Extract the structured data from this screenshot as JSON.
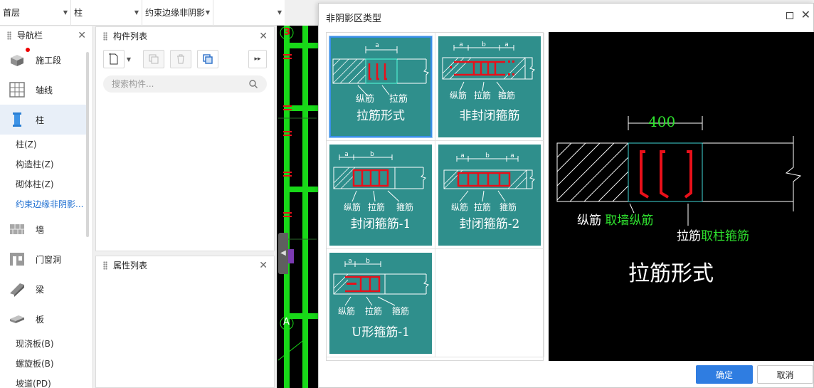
{
  "topbar": {
    "floor": "首层",
    "type": "柱",
    "subtype": "约束边缘非阴影"
  },
  "nav": {
    "title": "导航栏",
    "categories": [
      {
        "label": "施工段",
        "icon": "construction-section-icon"
      },
      {
        "label": "轴线",
        "icon": "grid-axis-icon"
      },
      {
        "label": "柱",
        "icon": "column-icon"
      }
    ],
    "column_items": [
      "柱(Z)",
      "构造柱(Z)",
      "砌体柱(Z)",
      "约束边缘非阴影..."
    ],
    "categories2": [
      {
        "label": "墙",
        "icon": "wall-icon"
      },
      {
        "label": "门窗洞",
        "icon": "door-window-icon"
      },
      {
        "label": "梁",
        "icon": "beam-icon"
      },
      {
        "label": "板",
        "icon": "slab-icon"
      }
    ],
    "slab_items": [
      "现浇板(B)",
      "螺旋板(B)",
      "坡道(PD)"
    ]
  },
  "component_list": {
    "title": "构件列表",
    "search_placeholder": "搜索构件..."
  },
  "property_list": {
    "title": "属性列表"
  },
  "cad": {
    "axis_top": "3",
    "axis_bottom": "A"
  },
  "dialog": {
    "title": "非阴影区类型",
    "options": [
      {
        "label": "拉筋形式",
        "dims": [
          "a"
        ],
        "notes": [
          "纵筋",
          "拉筋"
        ],
        "selected": true
      },
      {
        "label": "非封闭箍筋",
        "dims": [
          "a",
          "b",
          "a"
        ],
        "notes": [
          "纵筋",
          "拉筋",
          "箍筋"
        ],
        "selected": false
      },
      {
        "label": "封闭箍筋-1",
        "dims": [
          "a",
          "b"
        ],
        "notes": [
          "纵筋",
          "拉筋",
          "箍筋"
        ],
        "selected": false
      },
      {
        "label": "封闭箍筋-2",
        "dims": [
          "a",
          "b",
          "a"
        ],
        "notes": [
          "纵筋",
          "拉筋",
          "箍筋"
        ],
        "selected": false
      },
      {
        "label": "U形箍筋-1",
        "dims": [
          "a",
          "b"
        ],
        "notes": [
          "纵筋",
          "拉筋",
          "箍筋"
        ],
        "selected": false
      }
    ],
    "preview": {
      "dimension": "400",
      "note1_prefix": "纵筋",
      "note1_value": "取墙纵筋",
      "note2_prefix": "拉筋",
      "note2_value": "取柱箍筋",
      "caption": "拉筋形式"
    },
    "ok": "确定",
    "cancel": "取消"
  },
  "colors": {
    "card_bg": "#2f8f8c",
    "accent": "#2f7de1",
    "rebar": "#e8101a",
    "cad_green": "#18d818"
  }
}
